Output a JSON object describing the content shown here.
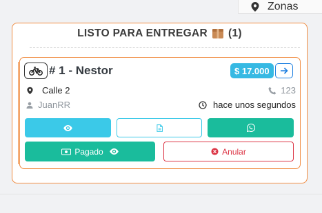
{
  "topbar": {
    "zonas_label": "Zonas"
  },
  "group": {
    "title": "LISTO PARA ENTREGAR",
    "count": "(1)",
    "accent_color": "#f08a3e"
  },
  "order": {
    "title": "# 1 - Nestor",
    "price": "$ 17.000",
    "address": "Calle 2",
    "phone": "123",
    "user": "JuanRR",
    "time": "hace unos segundos",
    "paid_label": "Pagado",
    "cancel_label": "Anular"
  },
  "icons": {
    "delivery": "bicycle-icon",
    "view": "eye-icon",
    "document": "file-icon",
    "chat": "whatsapp-icon",
    "location": "map-pin-icon",
    "phone": "phone-icon",
    "user": "user-icon",
    "time": "clock-icon",
    "cash": "money-icon",
    "cancel": "x-circle-icon",
    "go": "arrow-right-icon",
    "box": "package-icon"
  },
  "colors": {
    "info": "#36b9e3",
    "success": "#1abc9c",
    "danger": "#dc3545",
    "primary": "#1d7fe0"
  }
}
